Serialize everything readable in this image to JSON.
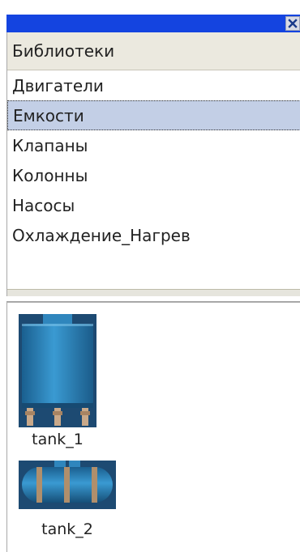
{
  "window": {
    "close_icon": "close-icon"
  },
  "libraries": {
    "header": "Библиотеки",
    "items": [
      {
        "label": "Двигатели",
        "selected": false
      },
      {
        "label": "Емкости",
        "selected": true
      },
      {
        "label": "Клапаны",
        "selected": false
      },
      {
        "label": "Колонны",
        "selected": false
      },
      {
        "label": "Насосы",
        "selected": false
      },
      {
        "label": "Охлаждение_Нагрев",
        "selected": false
      }
    ]
  },
  "elements": [
    {
      "label": "tank_1",
      "icon": "vertical-tank-icon"
    },
    {
      "label": "tank_2",
      "icon": "horizontal-tank-icon"
    }
  ],
  "colors": {
    "titlebar": "#1444e0",
    "selection": "#c3cfe6",
    "tank_blue": "#2a7fb8"
  }
}
